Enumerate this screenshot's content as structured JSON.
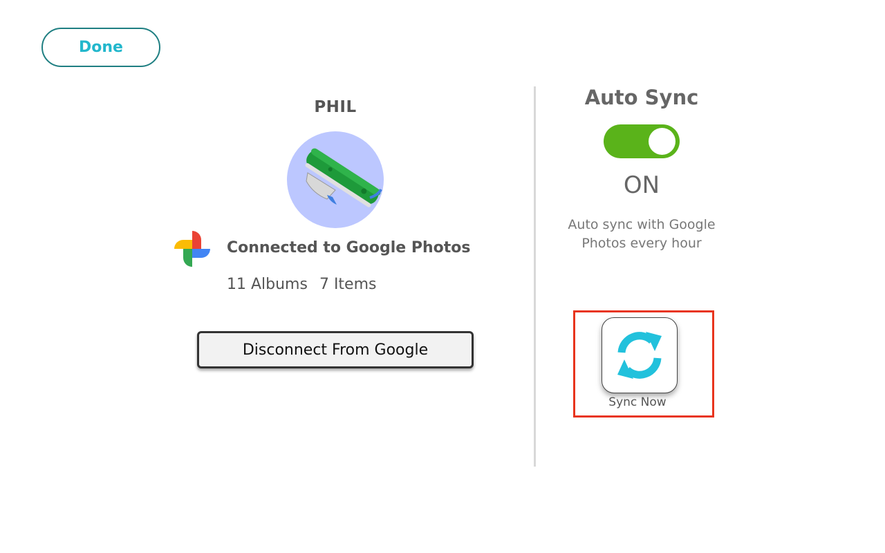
{
  "header": {
    "done_label": "Done"
  },
  "account": {
    "name": "PHIL",
    "avatar_bg": "#bcc7ff",
    "service_icon": "google-photos-icon",
    "connected_text": "Connected to Google Photos",
    "albums": "11 Albums",
    "items": "7 Items",
    "disconnect_label": "Disconnect From Google"
  },
  "sync": {
    "title": "Auto Sync",
    "toggle_on": true,
    "toggle_color": "#5ab31a",
    "toggle_state": "ON",
    "description": "Auto sync with Google Photos every hour",
    "sync_now_label": "Sync Now",
    "sync_icon": "refresh-icon",
    "sync_icon_color": "#22c1dc",
    "highlight_color": "#e8341c"
  },
  "colors": {
    "accent": "#22b7cc",
    "done_border": "#1f7f82"
  }
}
